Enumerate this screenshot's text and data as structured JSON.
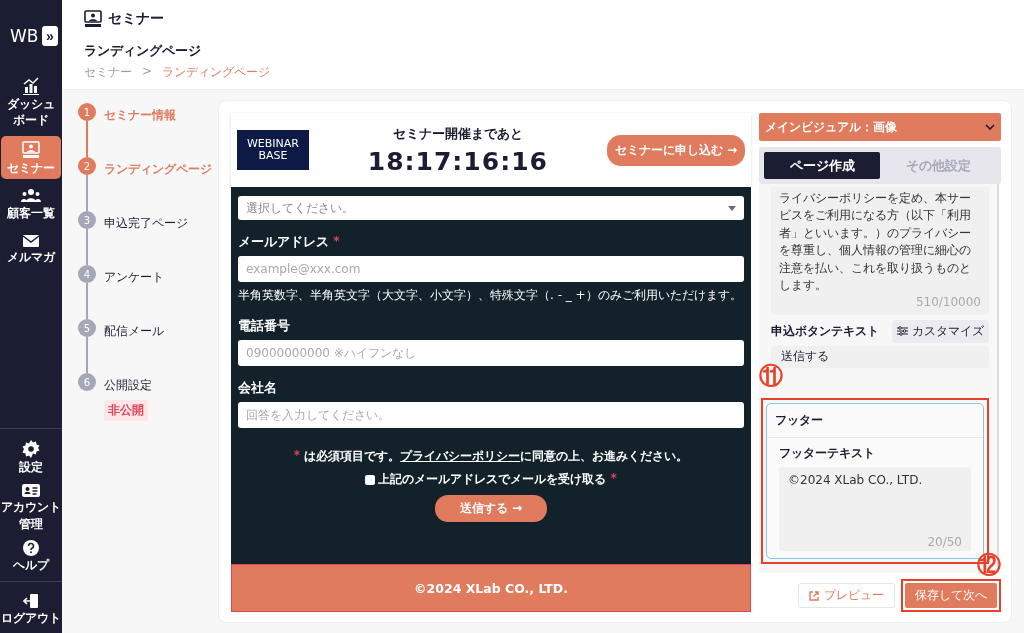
{
  "sidebar": {
    "logo": "WB",
    "toggle": "»",
    "items": [
      {
        "label_lines": [
          "ダッシュ",
          "ボード"
        ],
        "selected": false
      },
      {
        "label_lines": [
          "セミナー"
        ],
        "selected": true
      },
      {
        "label_lines": [
          "顧客一覧"
        ],
        "selected": false
      },
      {
        "label_lines": [
          "メルマガ"
        ],
        "selected": false
      }
    ],
    "bottom_items": [
      {
        "label_lines": [
          "設定"
        ]
      },
      {
        "label_lines": [
          "アカウント",
          "管理"
        ]
      },
      {
        "label_lines": [
          "ヘルプ"
        ]
      }
    ],
    "logout": "ログアウト"
  },
  "header": {
    "title": "セミナー",
    "subtitle": "ランディングページ",
    "breadcrumb": [
      {
        "label": "セミナー",
        "selected": false
      },
      {
        "label": "ランディングページ",
        "selected": true
      }
    ],
    "separator": ">"
  },
  "steps": [
    {
      "number": "1",
      "label": "セミナー情報",
      "active": true
    },
    {
      "number": "2",
      "label": "ランディングページ",
      "active": true
    },
    {
      "number": "3",
      "label": "申込完了ページ",
      "active": false
    },
    {
      "number": "4",
      "label": "アンケート",
      "active": false
    },
    {
      "number": "5",
      "label": "配信メール",
      "active": false
    },
    {
      "number": "6",
      "label": "公開設定",
      "active": false,
      "badge": "非公開"
    }
  ],
  "preview": {
    "logo_top": "WEBINAR",
    "logo_bottom": "BASE",
    "countdown_title": "セミナー開催まであと",
    "countdown": "18:17:16:16",
    "apply_button": "セミナーに申し込む →",
    "select_placeholder": "選択してください。",
    "fields": [
      {
        "label": "メールアドレス",
        "required": true,
        "placeholder": "example@xxx.com",
        "hint": "半角英数字、半角英文字（大文字、小文字）、特殊文字（. - _ +）のみご利用いただけます。"
      },
      {
        "label": "電話番号",
        "required": false,
        "placeholder": "09000000000 ※ハイフンなし"
      },
      {
        "label": "会社名",
        "required": false,
        "placeholder": "回答を入力してください。"
      }
    ],
    "notice_before": "は必須項目です。",
    "notice_link": "プライバシーポリシー",
    "notice_after": "に同意の上、お進みください。",
    "checkbox": {
      "label": "上記のメールアドレスでメールを受け取る",
      "checked": false,
      "required": true
    },
    "required_mark": "*",
    "submit_button": "送信する →",
    "footer": "©2024 XLab CO., LTD."
  },
  "settings": {
    "accordion": "メインビジュアル：画像",
    "tabs": [
      {
        "label": "ページ作成",
        "selected": true
      },
      {
        "label": "その他設定",
        "selected": false
      }
    ],
    "policy_text": "ライバシーポリシーを定め、本サービスをご利用になる方（以下「利用者」といいます。）のプライバシーを尊重し、個人情報の管理に細心の注意を払い、これを取り扱うものとします。",
    "policy_count": "510/10000",
    "button_text_label": "申込ボタンテキスト",
    "customize_button": "カスタマイズ",
    "button_text_value": "送信する",
    "footer_section": {
      "title": "フッター",
      "label": "フッターテキスト",
      "value": "©2024 XLab CO., LTD.",
      "count": "20/50",
      "callout": "⑪"
    },
    "preview_button": "プレビュー",
    "save_button": "保存して次へ",
    "save_callout": "⑫"
  }
}
